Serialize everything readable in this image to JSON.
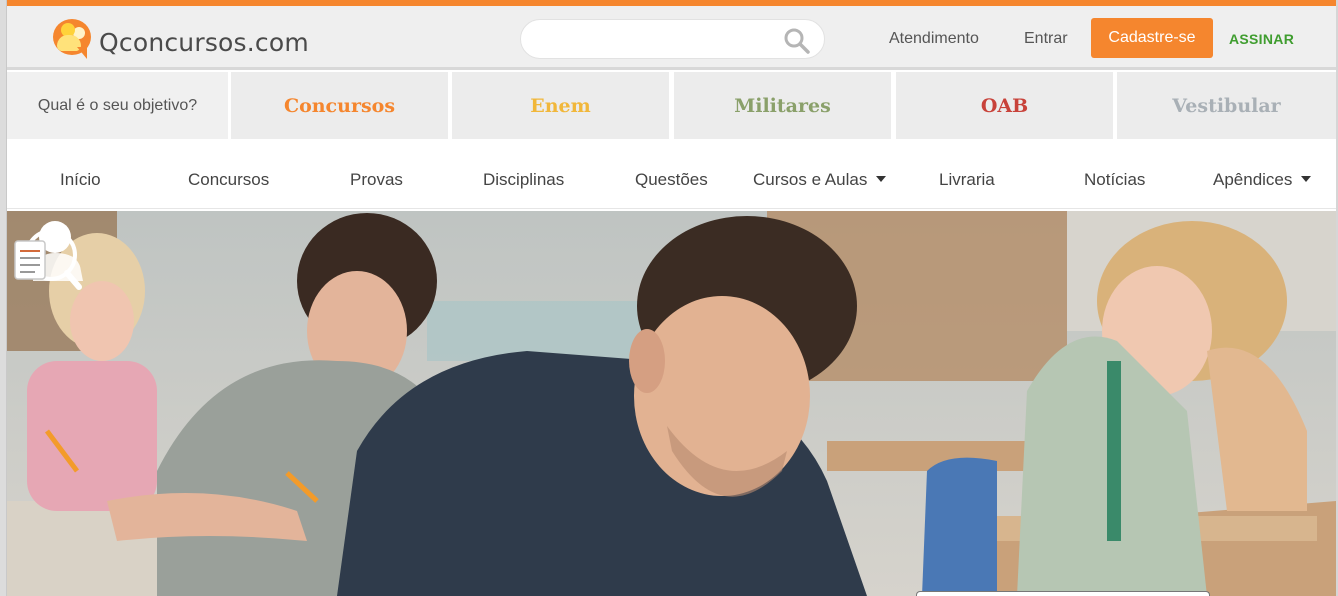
{
  "header": {
    "logo_text": "Qconcursos.com",
    "search": {
      "value": "",
      "placeholder": ""
    },
    "links": {
      "atendimento": "Atendimento",
      "entrar": "Entrar"
    },
    "signup_label": "Cadastre-se",
    "subscribe_label": "ASSINAR"
  },
  "objective": {
    "prompt": "Qual é o seu objetivo?",
    "tabs": [
      {
        "label": "Concursos",
        "color": "#f5862e"
      },
      {
        "label": "Enem",
        "color": "#f1b73a"
      },
      {
        "label": "Militares",
        "color": "#8aa06a"
      },
      {
        "label": "OAB",
        "color": "#c8423a"
      },
      {
        "label": "Vestibular",
        "color": "#a9b0b6"
      }
    ]
  },
  "nav": {
    "items": [
      {
        "label": "Início"
      },
      {
        "label": "Concursos"
      },
      {
        "label": "Provas"
      },
      {
        "label": "Disciplinas"
      },
      {
        "label": "Questões"
      },
      {
        "label": "Cursos e Aulas",
        "dropdown": true
      },
      {
        "label": "Livraria"
      },
      {
        "label": "Notícias"
      },
      {
        "label": "Apêndices",
        "dropdown": true
      }
    ]
  },
  "colors": {
    "accent": "#f5862e",
    "subscribe": "#3f9d2f"
  },
  "icons": {
    "search": "search-icon",
    "hero_badge": "exam-person-icon",
    "dropdown": "caret-down-icon"
  }
}
